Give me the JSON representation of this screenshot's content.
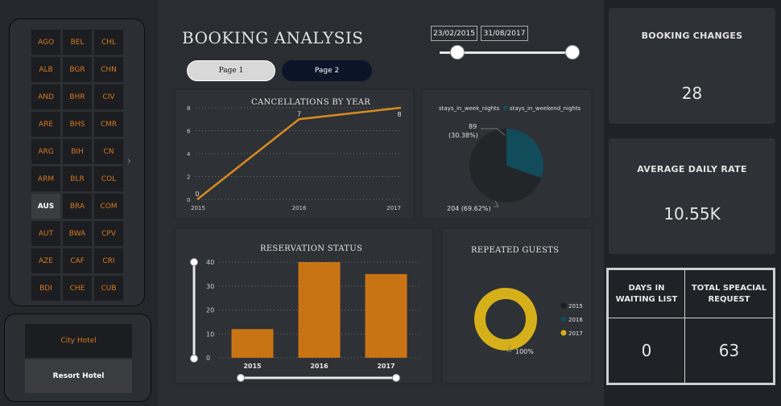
{
  "filters": {
    "countries": [
      "AGO",
      "BEL",
      "CHL",
      "ALB",
      "BGR",
      "CHN",
      "AND",
      "BHR",
      "CIV",
      "ARE",
      "BHS",
      "CMR",
      "ARG",
      "BIH",
      "CN",
      "ARM",
      "BLR",
      "COL",
      "AUS",
      "BRA",
      "COM",
      "AUT",
      "BWA",
      "CPV",
      "AZE",
      "CAF",
      "CRI",
      "BDI",
      "CHE",
      "CUB"
    ],
    "selected_country": "AUS",
    "hotels": {
      "city": "City Hotel",
      "resort": "Resort Hotel",
      "selected": "Resort Hotel"
    }
  },
  "header": {
    "title": "BOOKING ANALYSIS",
    "page1": "Page 1",
    "page2": "Page 2",
    "date_start": "23/02/2015",
    "date_end": "31/08/2017"
  },
  "colors": {
    "accent_orange": "#d77a22",
    "bar_orange": "#c97414",
    "line_orange": "#d68a22",
    "teal": "#124b5a",
    "gold": "#d6b01a",
    "pie_dark": "#232629"
  },
  "chart_data": [
    {
      "type": "line",
      "title": "CANCELLATIONS BY YEAR",
      "x": [
        "2015",
        "2016",
        "2017"
      ],
      "series": [
        {
          "values": [
            0,
            7,
            8
          ]
        }
      ],
      "data_labels": [
        "0",
        "7",
        "8"
      ],
      "yticks": [
        "0",
        "2",
        "4",
        "6",
        "8"
      ],
      "ylim": [
        0,
        8
      ],
      "grid": true
    },
    {
      "type": "pie",
      "legend": [
        "stays_in_week_nights",
        "stays_in_weekend_nights"
      ],
      "values": [
        204,
        89
      ],
      "labels": [
        "204 (69.62%)",
        "89 (30.38%)"
      ]
    },
    {
      "type": "bar",
      "title": "RESERVATION STATUS",
      "categories": [
        "2015",
        "2016",
        "2017"
      ],
      "values": [
        12,
        40,
        35
      ],
      "yticks": [
        "0",
        "10",
        "20",
        "30",
        "40"
      ],
      "ylim": [
        0,
        40
      ],
      "grid": true
    },
    {
      "type": "pie",
      "title": "REPEATED GUESTS",
      "legend": [
        "2015",
        "2016",
        "2017"
      ],
      "values": [
        0,
        0,
        100
      ],
      "labels": [
        "100%"
      ]
    }
  ],
  "kpis": {
    "booking_changes_title": "BOOKING CHANGES",
    "booking_changes_value": "28",
    "adr_title": "AVERAGE DAILY RATE",
    "adr_value": "10.55K",
    "days_waiting_title_1": "DAYS IN",
    "days_waiting_title_2": "WAITING LIST",
    "days_waiting_value": "0",
    "special_title_1": "TOTAL SPEACIAL",
    "special_title_2": "REQUEST",
    "special_value": "63"
  }
}
